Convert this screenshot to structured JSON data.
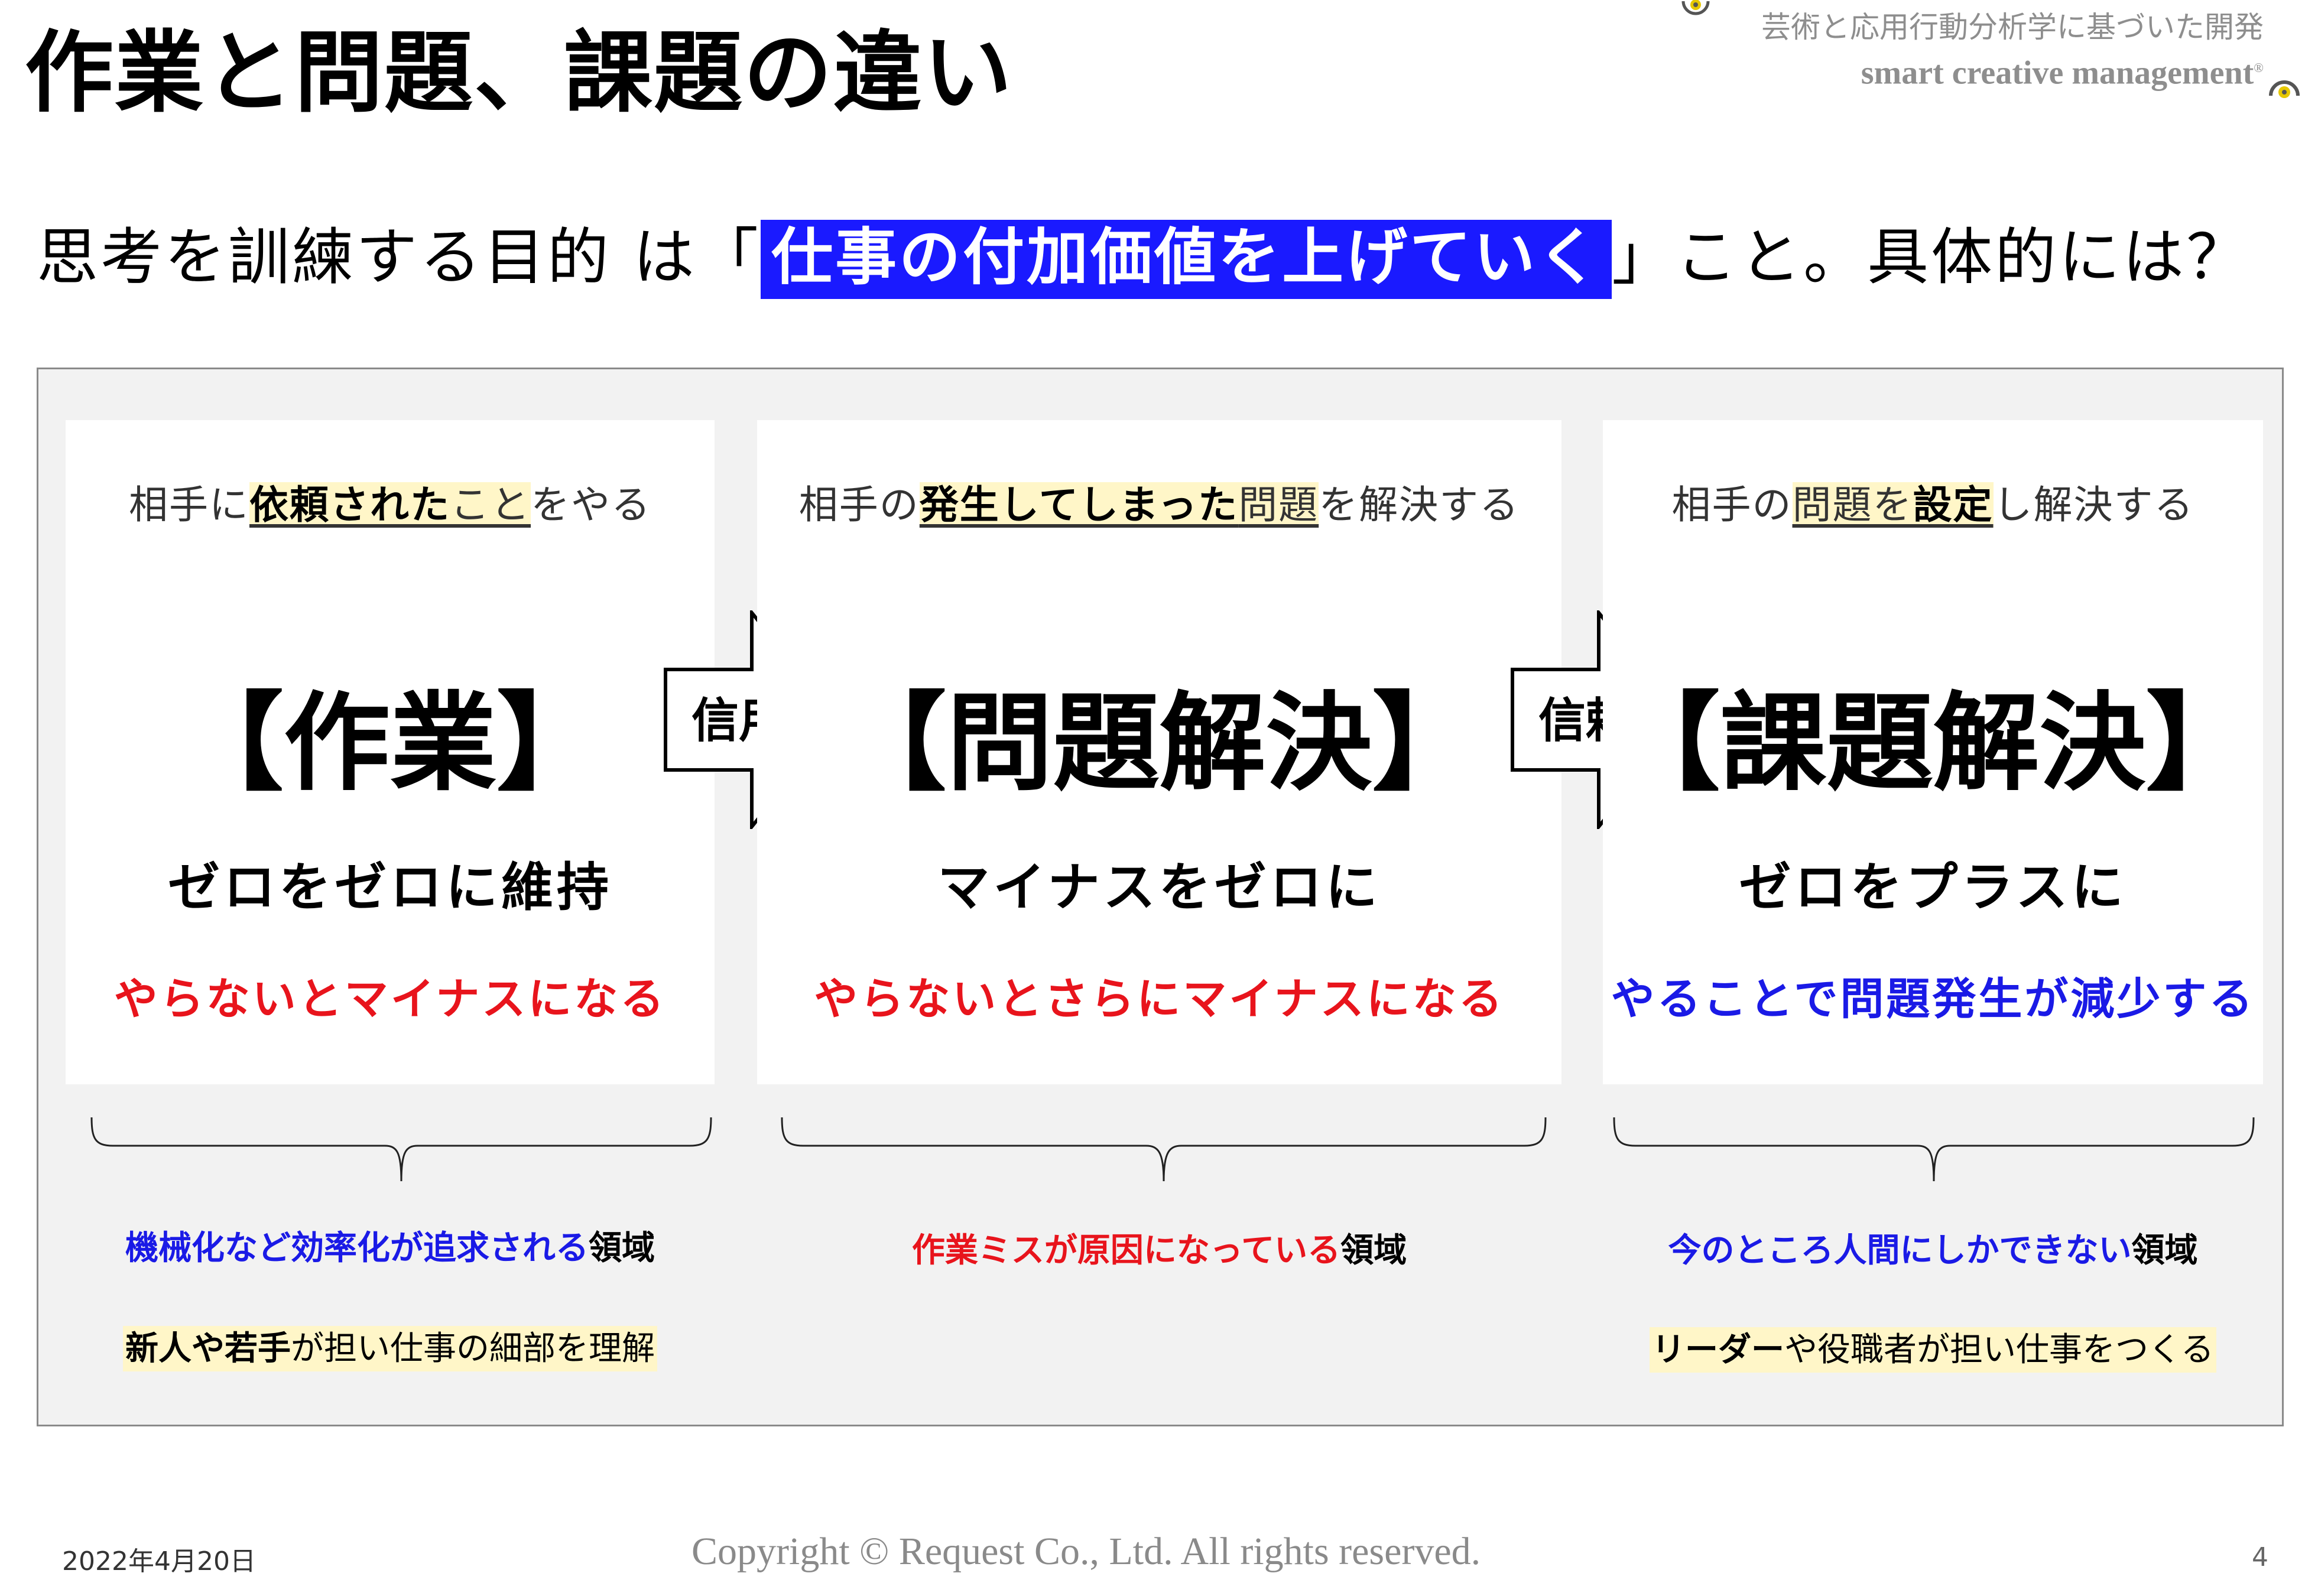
{
  "header": {
    "title": "作業と問題、課題の違い",
    "brand_jp": "芸術と応用行動分析学に基づいた開発",
    "brand_en": "smart creative management",
    "brand_reg": "®"
  },
  "subtitle": {
    "before": "思考を訓練する目的 は「",
    "highlight": "仕事の付加価値を上げていく",
    "after": "」こと。具体的には？"
  },
  "columns": [
    {
      "lead_pre": "相手に",
      "lead_bold": "依頼された",
      "lead_ul": "こと",
      "lead_post": "をやる",
      "big": "【作業】",
      "mid": "ゼロをゼロに維持",
      "low": "やらないとマイナスになる",
      "note1_blue": "機械化など効率化が追求される",
      "note1_black": "領域",
      "note2_bold": "新人や若手",
      "note2_rest": "が担い仕事の細部を理解"
    },
    {
      "lead_pre": "相手の",
      "lead_bold": "発生してしまった",
      "lead_ul": "問題",
      "lead_post": "を解決する",
      "big": "【問題解決】",
      "mid": "マイナスをゼロに",
      "low": "やらないとさらにマイナスになる",
      "note1_red": "作業ミスが原因になっている",
      "note1_black": "領域"
    },
    {
      "lead_pre": "相手の",
      "lead_ul": "問題を",
      "lead_bold": "設定",
      "lead_post": "し解決する",
      "big": "【課題解決】",
      "mid": "ゼロをプラスに",
      "low": "やることで問題発生が減少する",
      "note1_blue": "今のところ人間にしかできない",
      "note1_black": "領域",
      "note2_bold": "リーダー",
      "note2_rest": "や役職者が担い仕事をつくる"
    }
  ],
  "arrows": [
    {
      "label": "信用"
    },
    {
      "label": "信頼"
    }
  ],
  "footer": {
    "date": "2022年4月20日",
    "copyright": "Copyright © Request Co., Ltd.  All rights reserved.",
    "page": "4"
  },
  "colors": {
    "highlight_bg": "#1a1aff",
    "red": "#e8141c",
    "blue": "#1a1ae6",
    "marker": "#fff6c8"
  }
}
